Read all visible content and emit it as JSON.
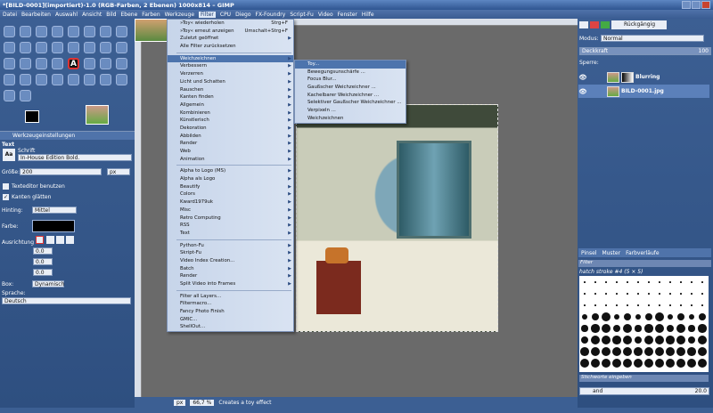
{
  "window": {
    "title": "*[BILD-0001](importiert)-1.0 (RGB-Farben, 2 Ebenen) 1000x814 – GIMP"
  },
  "menubar": [
    "Datei",
    "Bearbeiten",
    "Auswahl",
    "Ansicht",
    "Bild",
    "Ebene",
    "Farben",
    "Werkzeuge",
    "Filter",
    "CPU",
    "Diego",
    "FX-Foundry",
    "Script-Fu",
    "Video",
    "Fenster",
    "Hilfe"
  ],
  "menubar_selected_index": 8,
  "tool_options": {
    "tab_label": "Werkzeugeinstellungen",
    "section": "Text",
    "font_label": "Schrift",
    "font_value": "In-House Edition Bold.",
    "size_label": "Größe:",
    "size_value": "200",
    "size_unit": "px",
    "editor_label": "Texteditor benutzen",
    "antialias_label": "Kanten glätten",
    "hinting_label": "Hinting:",
    "hinting_value": "Mittel",
    "color_label": "Farbe:",
    "justify_label": "Ausrichtung",
    "indent_value": "0.0",
    "spacing_value": "0.0",
    "letter_value": "0.0",
    "box_label": "Box:",
    "box_value": "Dynamisch",
    "language_label": "Sprache:",
    "language_value": "Deutsch"
  },
  "filters_menu": {
    "items": [
      {
        "label": "»Toy« wiederholen",
        "accel": "Strg+F"
      },
      {
        "label": "»Toy« erneut anzeigen",
        "accel": "Umschalt+Strg+F"
      },
      {
        "label": "Zuletzt geöffnet",
        "submenu": true
      },
      {
        "label": "Alle Filter zurücksetzen"
      },
      {
        "sep": true
      },
      {
        "label": "Weichzeichnen",
        "submenu": true,
        "highlight": true
      },
      {
        "label": "Verbessern",
        "submenu": true
      },
      {
        "label": "Verzerren",
        "submenu": true
      },
      {
        "label": "Licht und Schatten",
        "submenu": true
      },
      {
        "label": "Rauschen",
        "submenu": true
      },
      {
        "label": "Kanten finden",
        "submenu": true
      },
      {
        "label": "Allgemein",
        "submenu": true
      },
      {
        "label": "Kombinieren",
        "submenu": true
      },
      {
        "label": "Künstlerisch",
        "submenu": true
      },
      {
        "label": "Dekoration",
        "submenu": true
      },
      {
        "label": "Abbilden",
        "submenu": true
      },
      {
        "label": "Render",
        "submenu": true
      },
      {
        "label": "Web",
        "submenu": true
      },
      {
        "label": "Animation",
        "submenu": true
      },
      {
        "sep": true
      },
      {
        "label": "Alpha to Logo (MS)",
        "submenu": true
      },
      {
        "label": "Alpha als Logo",
        "submenu": true
      },
      {
        "label": "Beautify",
        "submenu": true
      },
      {
        "label": "Colors",
        "submenu": true
      },
      {
        "label": "Kward1979uk",
        "submenu": true
      },
      {
        "label": "Misc",
        "submenu": true
      },
      {
        "label": "Retro Computing",
        "submenu": true
      },
      {
        "label": "RSS",
        "submenu": true
      },
      {
        "label": "Text",
        "submenu": true
      },
      {
        "sep": true
      },
      {
        "label": "Python-Fu",
        "submenu": true
      },
      {
        "label": "Skript-Fu",
        "submenu": true
      },
      {
        "label": "Video Index Creation...",
        "submenu": true
      },
      {
        "label": "Batch",
        "submenu": true
      },
      {
        "label": "Render",
        "submenu": true
      },
      {
        "label": "Split Video into Frames",
        "submenu": true
      },
      {
        "sep": true
      },
      {
        "label": "Filter all Layers..."
      },
      {
        "label": "Filtermacro..."
      },
      {
        "label": "Fancy Photo Finish"
      },
      {
        "label": "GMIC..."
      },
      {
        "label": "ShellOut..."
      }
    ]
  },
  "blur_submenu": {
    "items": [
      {
        "label": "Toy...",
        "highlight": true
      },
      {
        "label": "Bewegungsunschärfe ..."
      },
      {
        "label": "Focus Blur..."
      },
      {
        "label": "Gaußscher Weichzeichner ..."
      },
      {
        "label": "Kachelbarer Weichzeichner ..."
      },
      {
        "label": "Selektiver Gaußscher Weichzeichner ..."
      },
      {
        "label": "Verpixeln ..."
      },
      {
        "label": "Weichzeichnen"
      }
    ]
  },
  "statusbar": {
    "unit": "px",
    "zoom": "66,7 %",
    "message": "Creates a toy effect"
  },
  "layers": {
    "undo_tab": "Rückgängig",
    "mode_label": "Modus:",
    "mode_value": "Normal",
    "opacity_label": "Deckkraft",
    "opacity_value": "100",
    "lock_label": "Sperre:",
    "rows": [
      {
        "name": "Blurring",
        "selected": false
      },
      {
        "name": "BILD-0001.jpg",
        "selected": true
      }
    ]
  },
  "brushes": {
    "tabs": [
      "Pinsel",
      "Muster",
      "Farbverläufe"
    ],
    "filter_label": "Filter",
    "current": "hatch stroke #4 (5 × 5)",
    "tag_placeholder": "Stichworte eingeben",
    "spacing_label": "and",
    "spacing_value": "20.0"
  },
  "colors": {
    "accent": "#3c5f93",
    "menu_bg": "#d0dcee",
    "highlight": "#4d74ad"
  }
}
